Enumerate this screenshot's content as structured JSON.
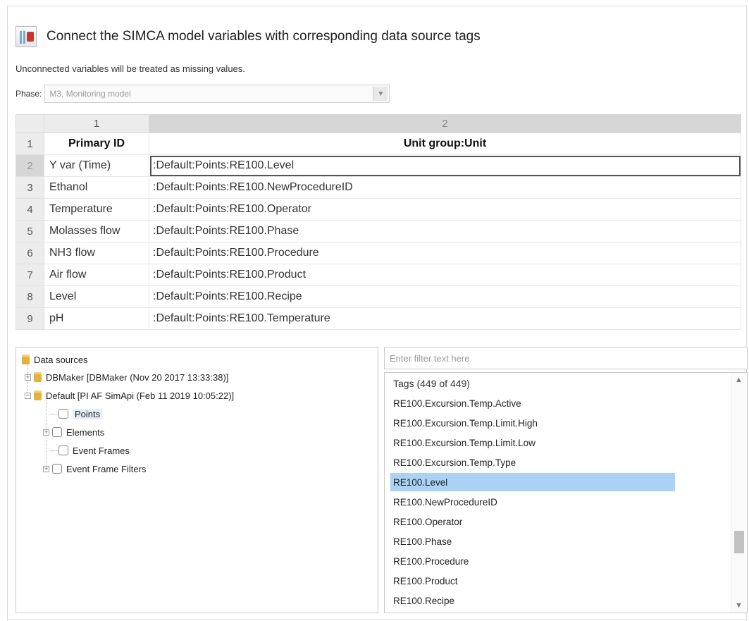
{
  "header": {
    "title": "Connect the SIMCA model variables with corresponding data source tags",
    "subtitle": "Unconnected variables will be treated as missing values.",
    "icon": "simca-connect-icon"
  },
  "phase": {
    "label": "Phase:",
    "value": "M3, Monitoring model"
  },
  "grid": {
    "col_numbers": [
      "1",
      "2"
    ],
    "head": {
      "row": "1",
      "col1": "Primary ID",
      "col2": "Unit group:Unit"
    },
    "rows": [
      {
        "num": "2",
        "var": "Y var (Time)",
        "tag": ":Default:Points:RE100.Level"
      },
      {
        "num": "3",
        "var": "Ethanol",
        "tag": ":Default:Points:RE100.NewProcedureID"
      },
      {
        "num": "4",
        "var": "Temperature",
        "tag": ":Default:Points:RE100.Operator"
      },
      {
        "num": "5",
        "var": "Molasses flow",
        "tag": ":Default:Points:RE100.Phase"
      },
      {
        "num": "6",
        "var": "NH3 flow",
        "tag": ":Default:Points:RE100.Procedure"
      },
      {
        "num": "7",
        "var": "Air flow",
        "tag": ":Default:Points:RE100.Product"
      },
      {
        "num": "8",
        "var": "Level",
        "tag": ":Default:Points:RE100.Recipe"
      },
      {
        "num": "9",
        "var": "pH",
        "tag": ":Default:Points:RE100.Temperature"
      }
    ]
  },
  "tree": {
    "root": "Data sources",
    "dbmaker": "DBMaker [DBMaker (Nov 20 2017 13:33:38)]",
    "default": "Default [PI AF SimApi (Feb 11 2019 10:05:22)]",
    "children": [
      "Points",
      "Elements",
      "Event Frames",
      "Event Frame Filters"
    ]
  },
  "tags": {
    "filter_placeholder": "Enter filter text here",
    "header": "Tags (449 of 449)",
    "items": [
      "RE100.Excursion.Temp.Active",
      "RE100.Excursion.Temp.Limit.High",
      "RE100.Excursion.Temp.Limit.Low",
      "RE100.Excursion.Temp.Type",
      "RE100.Level",
      "RE100.NewProcedureID",
      "RE100.Operator",
      "RE100.Phase",
      "RE100.Procedure",
      "RE100.Product",
      "RE100.Recipe"
    ],
    "selected": "RE100.Level"
  },
  "colors": {
    "selection": "#a9d2f5",
    "db_icon": "#e3b23c",
    "header_bg": "#ececec"
  }
}
